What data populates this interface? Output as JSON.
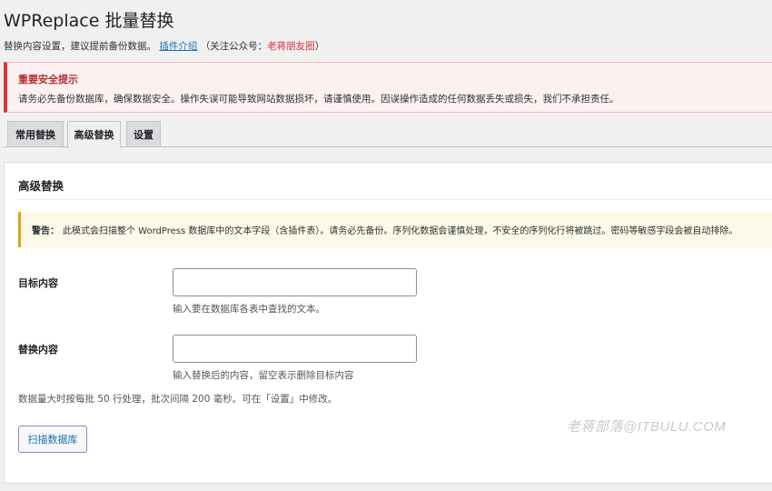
{
  "header": {
    "title": "WPReplace 批量替换",
    "subtitle_prefix": "替换内容设置，建议提前备份数据。",
    "plugin_link": "插件介绍",
    "follow_prefix": "（关注公众号：",
    "account_name": "老蒋朋友圈",
    "follow_suffix": "）"
  },
  "security_notice": {
    "title": "重要安全提示",
    "body": "请务必先备份数据库，确保数据安全。操作失误可能导致网站数据损坏，请谨慎使用。因误操作造成的任何数据丢失或损失，我们不承担责任。"
  },
  "tabs": [
    {
      "label": "常用替换",
      "active": false
    },
    {
      "label": "高级替换",
      "active": true
    },
    {
      "label": "设置",
      "active": false
    }
  ],
  "advanced": {
    "title": "高级替换",
    "warning_label": "警告：",
    "warning_text": "此模式会扫描整个 WordPress 数据库中的文本字段（含插件表）。请务必先备份。序列化数据会谨慎处理，不安全的序列化行将被跳过。密码等敏感字段会被自动排除。",
    "target_label": "目标内容",
    "target_value": "",
    "target_help": "输入要在数据库各表中查找的文本。",
    "replace_label": "替换内容",
    "replace_value": "",
    "replace_help": "输入替换后的内容，留空表示删除目标内容",
    "batch_note": "数据量大时按每批 50 行处理，批次间隔 200 毫秒。可在「设置」中修改。",
    "scan_button": "扫描数据库"
  },
  "watermark": "老蒋部落@ITBULU.COM",
  "colors": {
    "link": "#2271b1",
    "error": "#d63638",
    "warning": "#dba617",
    "background": "#f0f0f1"
  }
}
